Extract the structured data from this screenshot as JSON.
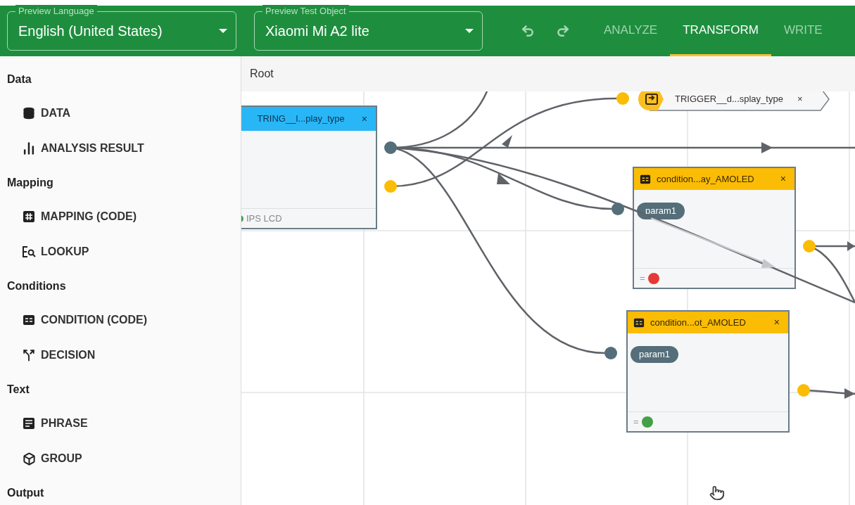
{
  "header": {
    "fields": [
      {
        "label": "Preview Language",
        "value": "English (United States)"
      },
      {
        "label": "Preview Test Object",
        "value": "Xiaomi Mi A2 lite"
      }
    ],
    "tabs": [
      {
        "label": "ANALYZE",
        "selected": false
      },
      {
        "label": "TRANSFORM",
        "selected": true
      },
      {
        "label": "WRITE",
        "selected": false
      }
    ]
  },
  "sidebar": {
    "sections": [
      {
        "title": "Data",
        "items": [
          {
            "label": "DATA",
            "kind": "data"
          },
          {
            "label": "ANALYSIS RESULT",
            "kind": "analysis"
          }
        ]
      },
      {
        "title": "Mapping",
        "items": [
          {
            "label": "MAPPING (CODE)",
            "kind": "mapping"
          },
          {
            "label": "LOOKUP",
            "kind": "lookup"
          }
        ]
      },
      {
        "title": "Conditions",
        "items": [
          {
            "label": "CONDITION (CODE)",
            "kind": "condition"
          },
          {
            "label": "DECISION",
            "kind": "decision"
          }
        ]
      },
      {
        "title": "Text",
        "items": [
          {
            "label": "PHRASE",
            "kind": "phrase"
          },
          {
            "label": "GROUP",
            "kind": "group"
          }
        ]
      },
      {
        "title": "Output"
      }
    ]
  },
  "breadcrumb": "Root",
  "nodes": [
    {
      "kind": "string",
      "title": "TRING__l...play_type",
      "close": "×",
      "footer": "IPS LCD",
      "color": "#43a047"
    },
    {
      "kind": "trigger",
      "title": "TRIGGER__d...splay_type",
      "close": "×"
    },
    {
      "kind": "condition",
      "title": "condition...ay_AMOLED",
      "close": "×",
      "param": "param1",
      "footer": "=",
      "color": "#e53935"
    },
    {
      "kind": "condition",
      "title": "condition...ot_AMOLED",
      "close": "×",
      "param": "param1",
      "footer": "=",
      "color": "#43a047"
    }
  ]
}
